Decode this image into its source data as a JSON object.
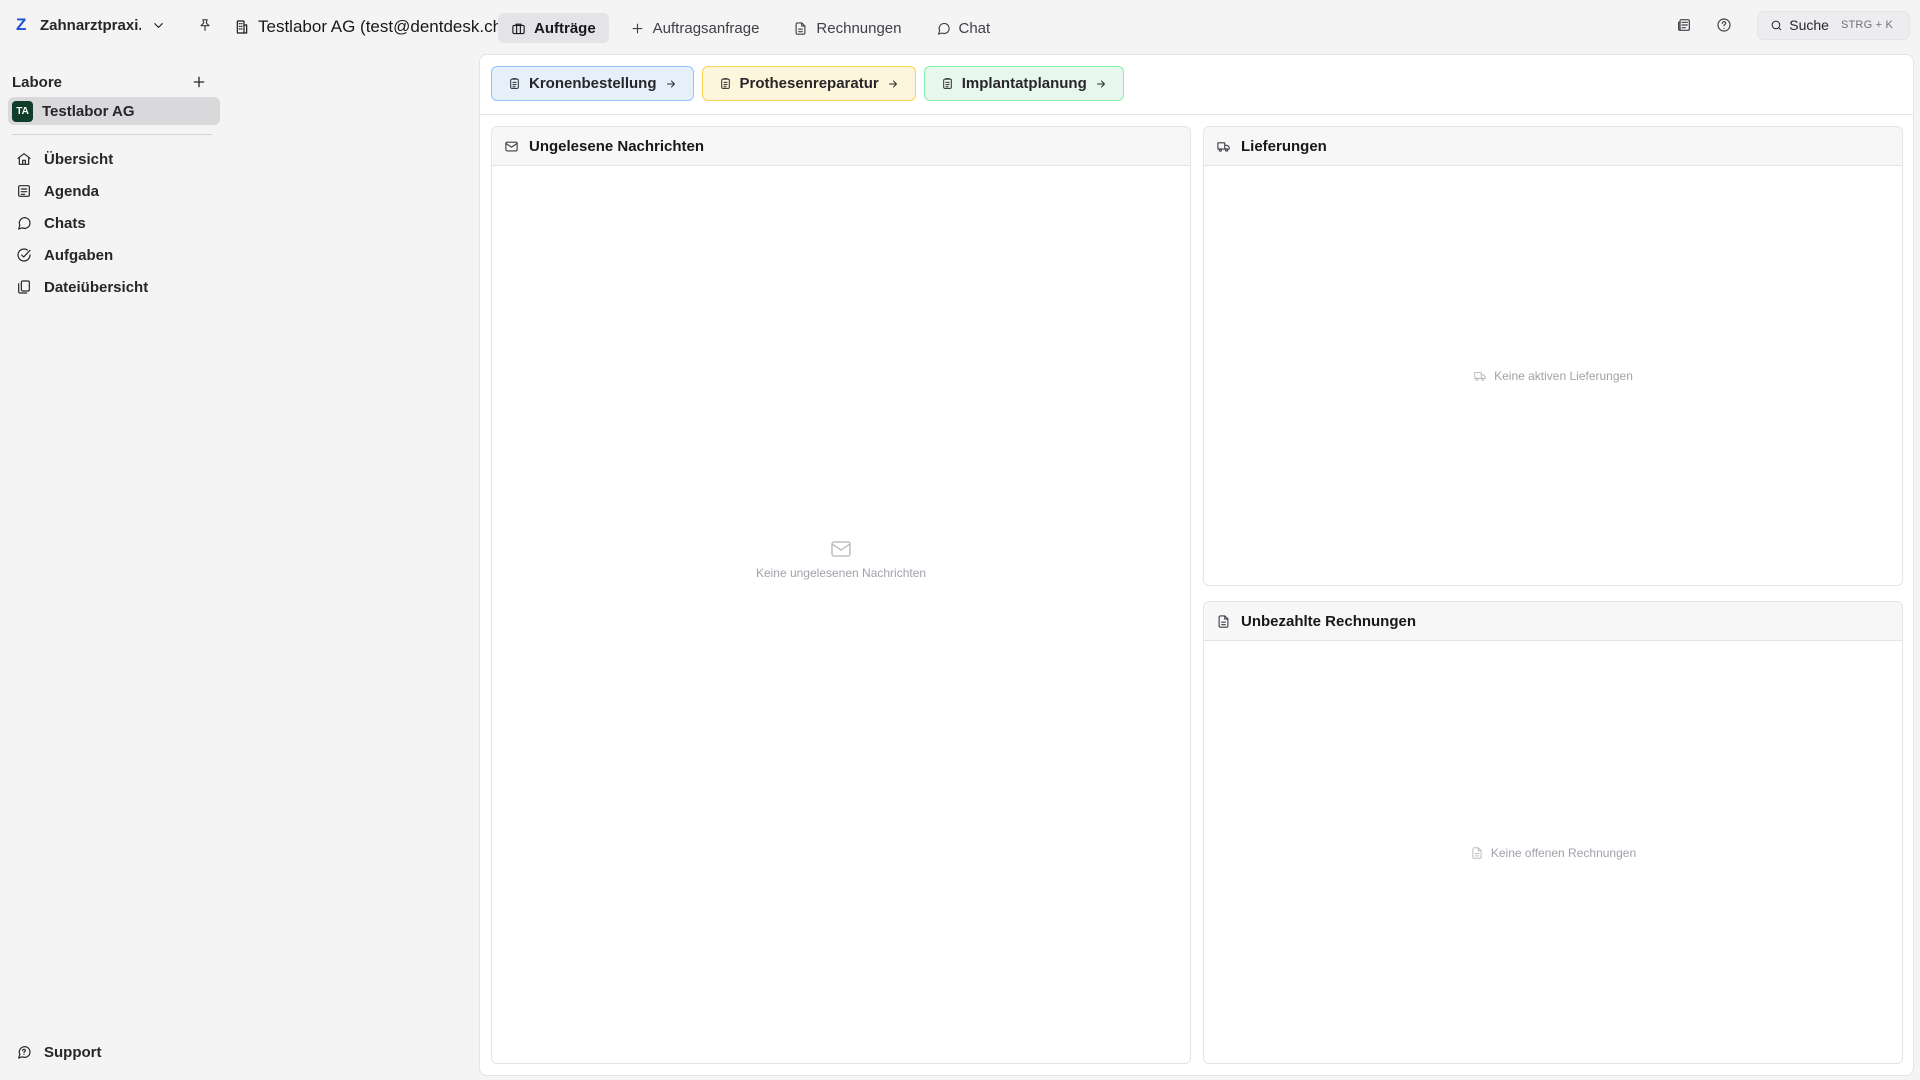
{
  "header": {
    "workspace_logo": "Z",
    "workspace_name": "Zahnarztpraxi...",
    "lab_title": "Testlabor AG (test@dentdesk.ch)",
    "tabs": [
      {
        "label": "Aufträge",
        "icon": "briefcase-icon",
        "active": true
      },
      {
        "label": "Auftragsanfrage",
        "icon": "plus-icon",
        "active": false
      },
      {
        "label": "Rechnungen",
        "icon": "file-text-icon",
        "active": false
      },
      {
        "label": "Chat",
        "icon": "message-circle-icon",
        "active": false
      }
    ],
    "search_label": "Suche",
    "search_shortcut": "STRG + K"
  },
  "sidebar": {
    "section_label": "Labore",
    "lab": {
      "avatar": "TA",
      "name": "Testlabor AG"
    },
    "items": [
      {
        "label": "Übersicht",
        "icon": "home-icon"
      },
      {
        "label": "Agenda",
        "icon": "agenda-icon"
      },
      {
        "label": "Chats",
        "icon": "message-circle-icon"
      },
      {
        "label": "Aufgaben",
        "icon": "check-circle-icon"
      },
      {
        "label": "Dateiübersicht",
        "icon": "files-icon"
      }
    ],
    "support_label": "Support"
  },
  "quick_actions": [
    {
      "label": "Kronenbestellung",
      "color": "#93c5fd"
    },
    {
      "label": "Prothesenreparatur",
      "color": "#fcd34d"
    },
    {
      "label": "Implantatplanung",
      "color": "#86efac"
    }
  ],
  "cards": {
    "messages": {
      "title": "Ungelesene Nachrichten",
      "empty": "Keine ungelesenen Nachrichten"
    },
    "deliveries": {
      "title": "Lieferungen",
      "empty": "Keine aktiven Lieferungen"
    },
    "invoices": {
      "title": "Unbezahlte Rechnungen",
      "empty": "Keine offenen Rechnungen"
    }
  }
}
